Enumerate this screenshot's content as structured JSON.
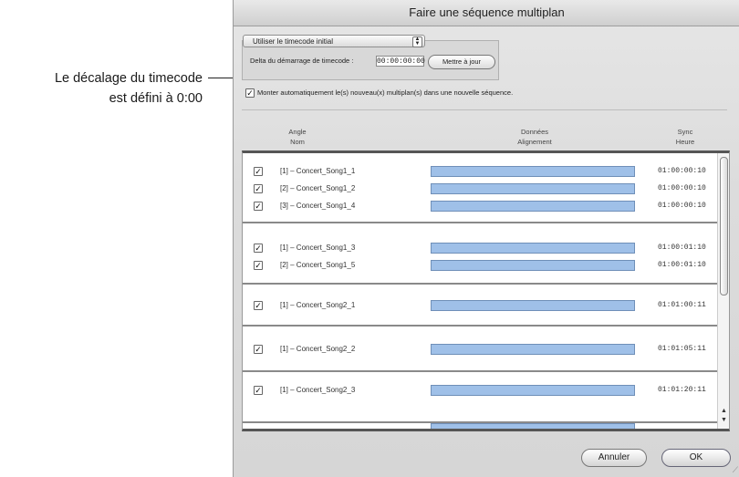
{
  "callout": {
    "line1": "Le décalage du timecode",
    "line2": "est défini à 0:00"
  },
  "window": {
    "title": "Faire une séquence multiplan",
    "popup_value": "Utiliser le timecode initial",
    "delta_label": "Delta du démarrage de timecode :",
    "delta_value": "00:00:00:00",
    "update_button": "Mettre à jour",
    "auto_open_label": "Monter automatiquement le(s) nouveau(x) multiplan(s) dans une nouvelle séquence.",
    "headers": {
      "angle": "Angle",
      "name": "Nom",
      "data": "Données",
      "alignment": "Alignement",
      "sync": "Sync",
      "time": "Heure"
    },
    "rows": [
      {
        "name": "[1] – Concert_Song1_1",
        "time": "01:00:00:10"
      },
      {
        "name": "[2] – Concert_Song1_2",
        "time": "01:00:00:10"
      },
      {
        "name": "[3] – Concert_Song1_4",
        "time": "01:00:00:10"
      },
      {
        "name": "[1] – Concert_Song1_3",
        "time": "01:00:01:10"
      },
      {
        "name": "[2] – Concert_Song1_5",
        "time": "01:00:01:10"
      },
      {
        "name": "[1] – Concert_Song2_1",
        "time": "01:01:00:11"
      },
      {
        "name": "[1] – Concert_Song2_2",
        "time": "01:01:05:11"
      },
      {
        "name": "[1] – Concert_Song2_3",
        "time": "01:01:20:11"
      }
    ],
    "cancel_button": "Annuler",
    "ok_button": "OK"
  }
}
